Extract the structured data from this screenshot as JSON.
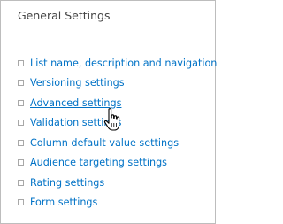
{
  "section": {
    "title": "General Settings"
  },
  "links": [
    {
      "label": "List name, description and navigation"
    },
    {
      "label": "Versioning settings"
    },
    {
      "label": "Advanced settings"
    },
    {
      "label": "Validation settings"
    },
    {
      "label": "Column default value settings"
    },
    {
      "label": "Audience targeting settings"
    },
    {
      "label": "Rating settings"
    },
    {
      "label": "Form settings"
    }
  ],
  "hovered_link": "Advanced settings",
  "cursor": {
    "icon": "hand-pointer-icon"
  },
  "colors": {
    "link": "#0072c6",
    "title": "#444444",
    "border": "#bdbdbd"
  }
}
